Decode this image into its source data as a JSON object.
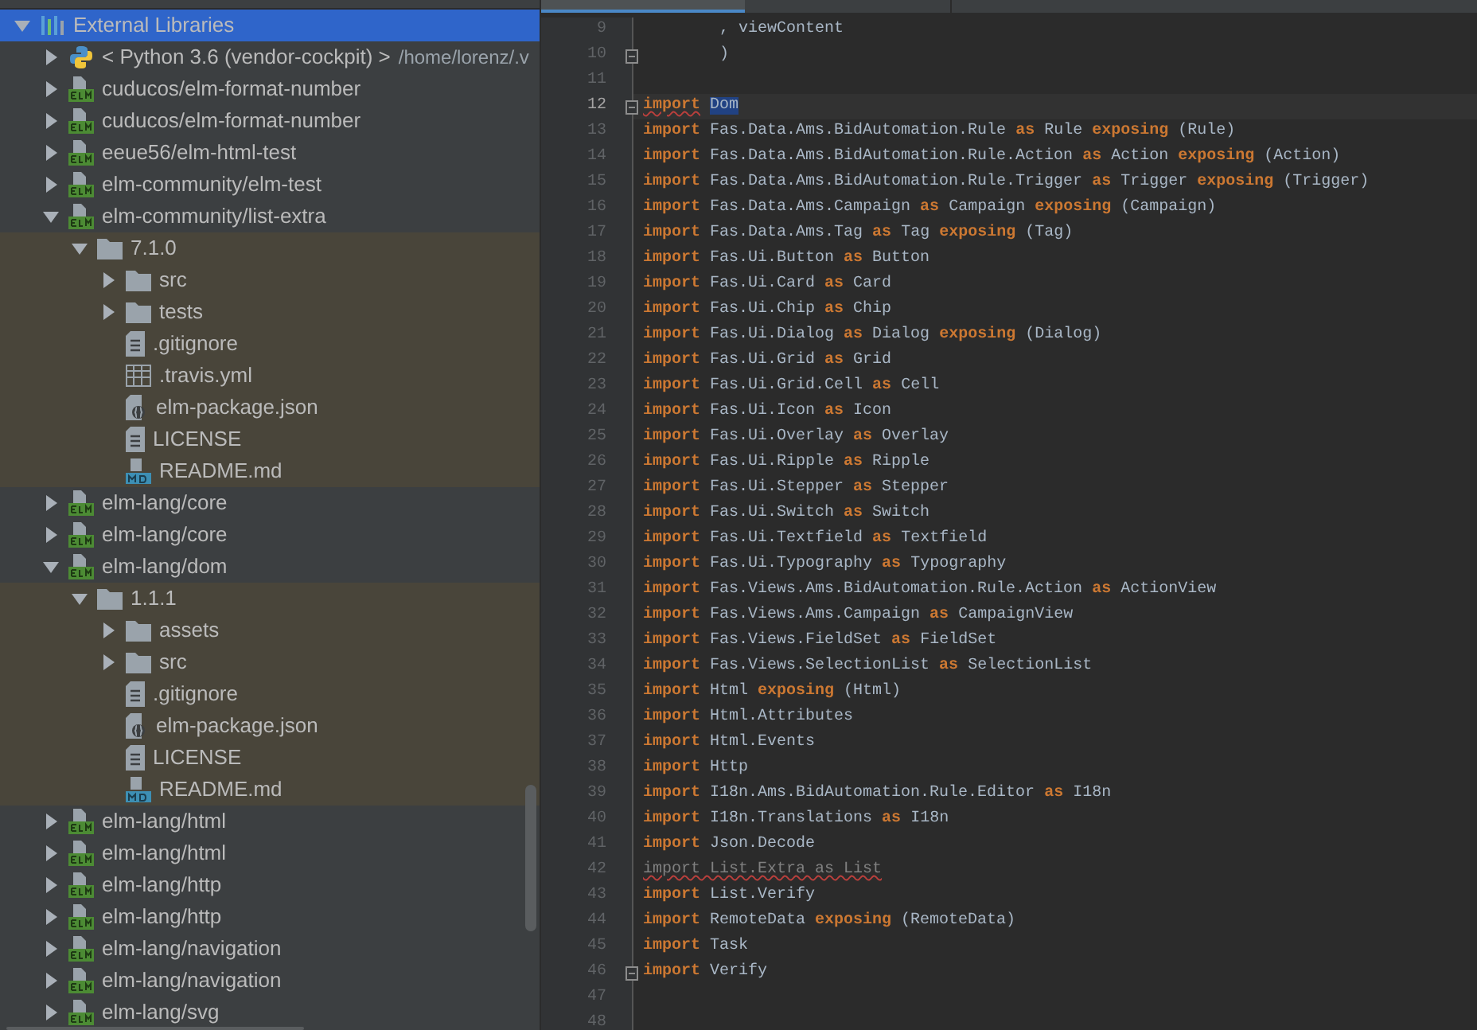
{
  "project_tree": [
    {
      "label": "External Libraries",
      "kind": "libraries",
      "expanded": true,
      "selected": true,
      "children": [
        {
          "label": "< Python 3.6 (vendor-cockpit) >",
          "path": "/home/lorenz/.v",
          "kind": "python",
          "expanded": false,
          "selected": false
        },
        {
          "label": "cuducos/elm-format-number",
          "kind": "elm",
          "expanded": false,
          "selected": false
        },
        {
          "label": "cuducos/elm-format-number",
          "kind": "elm",
          "expanded": false,
          "selected": false
        },
        {
          "label": "eeue56/elm-html-test",
          "kind": "elm",
          "expanded": false,
          "selected": false
        },
        {
          "label": "elm-community/elm-test",
          "kind": "elm",
          "expanded": false,
          "selected": false
        },
        {
          "label": "elm-community/list-extra",
          "kind": "elm",
          "expanded": true,
          "selected": false,
          "children": [
            {
              "label": "7.1.0",
              "kind": "folder",
              "expanded": true,
              "selected": false,
              "children": [
                {
                  "label": "src",
                  "kind": "folder",
                  "expanded": false,
                  "selected": false
                },
                {
                  "label": "tests",
                  "kind": "folder",
                  "expanded": false,
                  "selected": false
                },
                {
                  "label": ".gitignore",
                  "kind": "text",
                  "selected": false
                },
                {
                  "label": ".travis.yml",
                  "kind": "table",
                  "selected": false
                },
                {
                  "label": "elm-package.json",
                  "kind": "json",
                  "selected": false
                },
                {
                  "label": "LICENSE",
                  "kind": "text",
                  "selected": false
                },
                {
                  "label": "README.md",
                  "kind": "md",
                  "selected": false
                }
              ]
            }
          ]
        },
        {
          "label": "elm-lang/core",
          "kind": "elm",
          "expanded": false,
          "selected": false
        },
        {
          "label": "elm-lang/core",
          "kind": "elm",
          "expanded": false,
          "selected": false
        },
        {
          "label": "elm-lang/dom",
          "kind": "elm",
          "expanded": true,
          "selected": false,
          "children": [
            {
              "label": "1.1.1",
              "kind": "folder",
              "expanded": true,
              "selected": false,
              "children": [
                {
                  "label": "assets",
                  "kind": "folder",
                  "expanded": false,
                  "selected": false
                },
                {
                  "label": "src",
                  "kind": "folder",
                  "expanded": false,
                  "selected": false
                },
                {
                  "label": ".gitignore",
                  "kind": "text",
                  "selected": false
                },
                {
                  "label": "elm-package.json",
                  "kind": "json",
                  "selected": false
                },
                {
                  "label": "LICENSE",
                  "kind": "text",
                  "selected": false
                },
                {
                  "label": "README.md",
                  "kind": "md",
                  "selected": false
                }
              ]
            }
          ]
        },
        {
          "label": "elm-lang/html",
          "kind": "elm",
          "expanded": false,
          "selected": false
        },
        {
          "label": "elm-lang/html",
          "kind": "elm",
          "expanded": false,
          "selected": false
        },
        {
          "label": "elm-lang/http",
          "kind": "elm",
          "expanded": false,
          "selected": false
        },
        {
          "label": "elm-lang/http",
          "kind": "elm",
          "expanded": false,
          "selected": false
        },
        {
          "label": "elm-lang/navigation",
          "kind": "elm",
          "expanded": false,
          "selected": false
        },
        {
          "label": "elm-lang/navigation",
          "kind": "elm",
          "expanded": false,
          "selected": false
        },
        {
          "label": "elm-lang/svg",
          "kind": "elm",
          "expanded": false,
          "selected": false
        }
      ]
    }
  ],
  "editor": {
    "lines": [
      {
        "number": "9",
        "current": false,
        "fold": false,
        "tokens": [
          {
            "kind": "plain",
            "text": "        , viewContent"
          }
        ]
      },
      {
        "number": "10",
        "current": false,
        "fold": true,
        "tokens": [
          {
            "kind": "plain",
            "text": "        )"
          }
        ]
      },
      {
        "number": "11",
        "current": false,
        "fold": false
      },
      {
        "number": "12",
        "current": true,
        "fold": true,
        "tokens": [
          {
            "kind": "error",
            "text": "import"
          },
          {
            "kind": "selection",
            "text": "Dom"
          }
        ]
      },
      {
        "number": "13",
        "current": false,
        "fold": false,
        "tokens": [
          {
            "kind": "kw",
            "text": "import"
          },
          {
            "kind": "plain",
            "text": " Fas.Data.Ams.BidAutomation.Rule "
          },
          {
            "kind": "kw",
            "text": "as"
          },
          {
            "kind": "plain",
            "text": " Rule "
          },
          {
            "kind": "kw",
            "text": "exposing"
          },
          {
            "kind": "plain",
            "text": " (Rule)"
          }
        ]
      },
      {
        "number": "14",
        "current": false,
        "fold": false,
        "tokens": [
          {
            "kind": "kw",
            "text": "import"
          },
          {
            "kind": "plain",
            "text": " Fas.Data.Ams.BidAutomation.Rule.Action "
          },
          {
            "kind": "kw",
            "text": "as"
          },
          {
            "kind": "plain",
            "text": " Action "
          },
          {
            "kind": "kw",
            "text": "exposing"
          },
          {
            "kind": "plain",
            "text": " (Action)"
          }
        ]
      },
      {
        "number": "15",
        "current": false,
        "fold": false,
        "tokens": [
          {
            "kind": "kw",
            "text": "import"
          },
          {
            "kind": "plain",
            "text": " Fas.Data.Ams.BidAutomation.Rule.Trigger "
          },
          {
            "kind": "kw",
            "text": "as"
          },
          {
            "kind": "plain",
            "text": " Trigger "
          },
          {
            "kind": "kw",
            "text": "exposing"
          },
          {
            "kind": "plain",
            "text": " (Trigger)"
          }
        ]
      },
      {
        "number": "16",
        "current": false,
        "fold": false,
        "tokens": [
          {
            "kind": "kw",
            "text": "import"
          },
          {
            "kind": "plain",
            "text": " Fas.Data.Ams.Campaign "
          },
          {
            "kind": "kw",
            "text": "as"
          },
          {
            "kind": "plain",
            "text": " Campaign "
          },
          {
            "kind": "kw",
            "text": "exposing"
          },
          {
            "kind": "plain",
            "text": " (Campaign)"
          }
        ]
      },
      {
        "number": "17",
        "current": false,
        "fold": false,
        "tokens": [
          {
            "kind": "kw",
            "text": "import"
          },
          {
            "kind": "plain",
            "text": " Fas.Data.Ams.Tag "
          },
          {
            "kind": "kw",
            "text": "as"
          },
          {
            "kind": "plain",
            "text": " Tag "
          },
          {
            "kind": "kw",
            "text": "exposing"
          },
          {
            "kind": "plain",
            "text": " (Tag)"
          }
        ]
      },
      {
        "number": "18",
        "current": false,
        "fold": false,
        "tokens": [
          {
            "kind": "kw",
            "text": "import"
          },
          {
            "kind": "plain",
            "text": " Fas.Ui.Button "
          },
          {
            "kind": "kw",
            "text": "as"
          },
          {
            "kind": "plain",
            "text": " Button"
          }
        ]
      },
      {
        "number": "19",
        "current": false,
        "fold": false,
        "tokens": [
          {
            "kind": "kw",
            "text": "import"
          },
          {
            "kind": "plain",
            "text": " Fas.Ui.Card "
          },
          {
            "kind": "kw",
            "text": "as"
          },
          {
            "kind": "plain",
            "text": " Card"
          }
        ]
      },
      {
        "number": "20",
        "current": false,
        "fold": false,
        "tokens": [
          {
            "kind": "kw",
            "text": "import"
          },
          {
            "kind": "plain",
            "text": " Fas.Ui.Chip "
          },
          {
            "kind": "kw",
            "text": "as"
          },
          {
            "kind": "plain",
            "text": " Chip"
          }
        ]
      },
      {
        "number": "21",
        "current": false,
        "fold": false,
        "tokens": [
          {
            "kind": "kw",
            "text": "import"
          },
          {
            "kind": "plain",
            "text": " Fas.Ui.Dialog "
          },
          {
            "kind": "kw",
            "text": "as"
          },
          {
            "kind": "plain",
            "text": " Dialog "
          },
          {
            "kind": "kw",
            "text": "exposing"
          },
          {
            "kind": "plain",
            "text": " (Dialog)"
          }
        ]
      },
      {
        "number": "22",
        "current": false,
        "fold": false,
        "tokens": [
          {
            "kind": "kw",
            "text": "import"
          },
          {
            "kind": "plain",
            "text": " Fas.Ui.Grid "
          },
          {
            "kind": "kw",
            "text": "as"
          },
          {
            "kind": "plain",
            "text": " Grid"
          }
        ]
      },
      {
        "number": "23",
        "current": false,
        "fold": false,
        "tokens": [
          {
            "kind": "kw",
            "text": "import"
          },
          {
            "kind": "plain",
            "text": " Fas.Ui.Grid.Cell "
          },
          {
            "kind": "kw",
            "text": "as"
          },
          {
            "kind": "plain",
            "text": " Cell"
          }
        ]
      },
      {
        "number": "24",
        "current": false,
        "fold": false,
        "tokens": [
          {
            "kind": "kw",
            "text": "import"
          },
          {
            "kind": "plain",
            "text": " Fas.Ui.Icon "
          },
          {
            "kind": "kw",
            "text": "as"
          },
          {
            "kind": "plain",
            "text": " Icon"
          }
        ]
      },
      {
        "number": "25",
        "current": false,
        "fold": false,
        "tokens": [
          {
            "kind": "kw",
            "text": "import"
          },
          {
            "kind": "plain",
            "text": " Fas.Ui.Overlay "
          },
          {
            "kind": "kw",
            "text": "as"
          },
          {
            "kind": "plain",
            "text": " Overlay"
          }
        ]
      },
      {
        "number": "26",
        "current": false,
        "fold": false,
        "tokens": [
          {
            "kind": "kw",
            "text": "import"
          },
          {
            "kind": "plain",
            "text": " Fas.Ui.Ripple "
          },
          {
            "kind": "kw",
            "text": "as"
          },
          {
            "kind": "plain",
            "text": " Ripple"
          }
        ]
      },
      {
        "number": "27",
        "current": false,
        "fold": false,
        "tokens": [
          {
            "kind": "kw",
            "text": "import"
          },
          {
            "kind": "plain",
            "text": " Fas.Ui.Stepper "
          },
          {
            "kind": "kw",
            "text": "as"
          },
          {
            "kind": "plain",
            "text": " Stepper"
          }
        ]
      },
      {
        "number": "28",
        "current": false,
        "fold": false,
        "tokens": [
          {
            "kind": "kw",
            "text": "import"
          },
          {
            "kind": "plain",
            "text": " Fas.Ui.Switch "
          },
          {
            "kind": "kw",
            "text": "as"
          },
          {
            "kind": "plain",
            "text": " Switch"
          }
        ]
      },
      {
        "number": "29",
        "current": false,
        "fold": false,
        "tokens": [
          {
            "kind": "kw",
            "text": "import"
          },
          {
            "kind": "plain",
            "text": " Fas.Ui.Textfield "
          },
          {
            "kind": "kw",
            "text": "as"
          },
          {
            "kind": "plain",
            "text": " Textfield"
          }
        ]
      },
      {
        "number": "30",
        "current": false,
        "fold": false,
        "tokens": [
          {
            "kind": "kw",
            "text": "import"
          },
          {
            "kind": "plain",
            "text": " Fas.Ui.Typography "
          },
          {
            "kind": "kw",
            "text": "as"
          },
          {
            "kind": "plain",
            "text": " Typography"
          }
        ]
      },
      {
        "number": "31",
        "current": false,
        "fold": false,
        "tokens": [
          {
            "kind": "kw",
            "text": "import"
          },
          {
            "kind": "plain",
            "text": " Fas.Views.Ams.BidAutomation.Rule.Action "
          },
          {
            "kind": "kw",
            "text": "as"
          },
          {
            "kind": "plain",
            "text": " ActionView"
          }
        ]
      },
      {
        "number": "32",
        "current": false,
        "fold": false,
        "tokens": [
          {
            "kind": "kw",
            "text": "import"
          },
          {
            "kind": "plain",
            "text": " Fas.Views.Ams.Campaign "
          },
          {
            "kind": "kw",
            "text": "as"
          },
          {
            "kind": "plain",
            "text": " CampaignView"
          }
        ]
      },
      {
        "number": "33",
        "current": false,
        "fold": false,
        "tokens": [
          {
            "kind": "kw",
            "text": "import"
          },
          {
            "kind": "plain",
            "text": " Fas.Views.FieldSet "
          },
          {
            "kind": "kw",
            "text": "as"
          },
          {
            "kind": "plain",
            "text": " FieldSet"
          }
        ]
      },
      {
        "number": "34",
        "current": false,
        "fold": false,
        "tokens": [
          {
            "kind": "kw",
            "text": "import"
          },
          {
            "kind": "plain",
            "text": " Fas.Views.SelectionList "
          },
          {
            "kind": "kw",
            "text": "as"
          },
          {
            "kind": "plain",
            "text": " SelectionList"
          }
        ]
      },
      {
        "number": "35",
        "current": false,
        "fold": false,
        "tokens": [
          {
            "kind": "kw",
            "text": "import"
          },
          {
            "kind": "plain",
            "text": " Html "
          },
          {
            "kind": "kw",
            "text": "exposing"
          },
          {
            "kind": "plain",
            "text": " (Html)"
          }
        ]
      },
      {
        "number": "36",
        "current": false,
        "fold": false,
        "tokens": [
          {
            "kind": "kw",
            "text": "import"
          },
          {
            "kind": "plain",
            "text": " Html.Attributes"
          }
        ]
      },
      {
        "number": "37",
        "current": false,
        "fold": false,
        "tokens": [
          {
            "kind": "kw",
            "text": "import"
          },
          {
            "kind": "plain",
            "text": " Html.Events"
          }
        ]
      },
      {
        "number": "38",
        "current": false,
        "fold": false,
        "tokens": [
          {
            "kind": "kw",
            "text": "import"
          },
          {
            "kind": "plain",
            "text": " Http"
          }
        ]
      },
      {
        "number": "39",
        "current": false,
        "fold": false,
        "tokens": [
          {
            "kind": "kw",
            "text": "import"
          },
          {
            "kind": "plain",
            "text": " I18n.Ams.BidAutomation.Rule.Editor "
          },
          {
            "kind": "kw",
            "text": "as"
          },
          {
            "kind": "plain",
            "text": " I18n"
          }
        ]
      },
      {
        "number": "40",
        "current": false,
        "fold": false,
        "tokens": [
          {
            "kind": "kw",
            "text": "import"
          },
          {
            "kind": "plain",
            "text": " I18n.Translations "
          },
          {
            "kind": "kw",
            "text": "as"
          },
          {
            "kind": "plain",
            "text": " I18n"
          }
        ]
      },
      {
        "number": "41",
        "current": false,
        "fold": false,
        "tokens": [
          {
            "kind": "kw",
            "text": "import"
          },
          {
            "kind": "plain",
            "text": " Json.Decode"
          }
        ]
      },
      {
        "number": "42",
        "current": false,
        "fold": false,
        "tokens": [
          {
            "kind": "unused",
            "text": "import List.Extra as List"
          }
        ]
      },
      {
        "number": "43",
        "current": false,
        "fold": false,
        "tokens": [
          {
            "kind": "kw",
            "text": "import"
          },
          {
            "kind": "plain",
            "text": " List.Verify"
          }
        ]
      },
      {
        "number": "44",
        "current": false,
        "fold": false,
        "tokens": [
          {
            "kind": "kw",
            "text": "import"
          },
          {
            "kind": "plain",
            "text": " RemoteData "
          },
          {
            "kind": "kw",
            "text": "exposing"
          },
          {
            "kind": "plain",
            "text": " (RemoteData)"
          }
        ]
      },
      {
        "number": "45",
        "current": false,
        "fold": false,
        "tokens": [
          {
            "kind": "kw",
            "text": "import"
          },
          {
            "kind": "plain",
            "text": " Task"
          }
        ]
      },
      {
        "number": "46",
        "current": false,
        "fold": true,
        "tokens": [
          {
            "kind": "kw",
            "text": "import"
          },
          {
            "kind": "plain",
            "text": " Verify"
          }
        ]
      },
      {
        "number": "47",
        "current": false,
        "fold": false
      },
      {
        "number": "48",
        "current": false,
        "fold": false
      }
    ]
  }
}
